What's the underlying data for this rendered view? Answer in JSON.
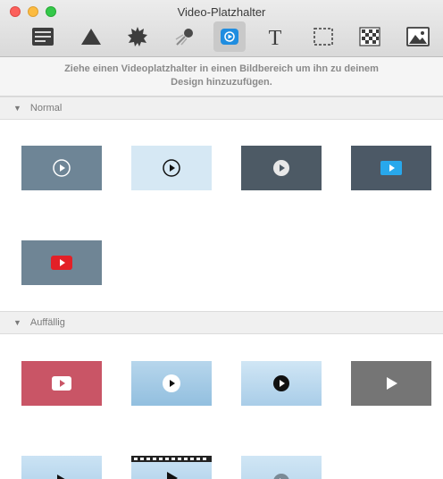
{
  "window": {
    "title": "Video-Platzhalter"
  },
  "toolbar": {
    "items": [
      {
        "icon": "text-frame-icon"
      },
      {
        "icon": "triangle-shape-icon"
      },
      {
        "icon": "badge-burst-icon"
      },
      {
        "icon": "comet-effect-icon"
      },
      {
        "icon": "video-placeholder-icon",
        "selected": true
      },
      {
        "icon": "text-T-icon"
      },
      {
        "icon": "selection-frame-icon"
      },
      {
        "icon": "checkerboard-pattern-icon"
      },
      {
        "icon": "image-placeholder-icon"
      }
    ]
  },
  "hint": {
    "line1": "Ziehe einen Videoplatzhalter in einen Bildbereich um ihn zu deinem",
    "line2": "Design hinzuzufügen."
  },
  "sections": [
    {
      "label": "Normal",
      "thumbnails": [
        {
          "style": "gray-blue with white play circle",
          "color": "#6e8596"
        },
        {
          "style": "light blue with black play circle",
          "color": "#d6e8f4"
        },
        {
          "style": "dark slate with white play disc",
          "color": "#4d5a65"
        },
        {
          "style": "dark slate with blue play button",
          "color": "#4c5966"
        },
        {
          "style": "gray-blue with red play button",
          "color": "#6f8595"
        }
      ]
    },
    {
      "label": "Auffällig",
      "thumbnails": [
        {
          "style": "crimson with white play button",
          "color": "#c95566"
        },
        {
          "style": "sky blue with white play disc",
          "color": "#9ec6e2"
        },
        {
          "style": "light blue with black play disc",
          "color": "#bcd9ee"
        },
        {
          "style": "gray with white play triangle",
          "color": "#757575"
        },
        {
          "style": "blue with black play triangle",
          "color": "#a9cde8"
        },
        {
          "style": "film strip with black play triangle",
          "color": "#b9d8ee"
        },
        {
          "style": "light blue with gray play disc",
          "color": "#bcd9ee"
        }
      ]
    }
  ]
}
